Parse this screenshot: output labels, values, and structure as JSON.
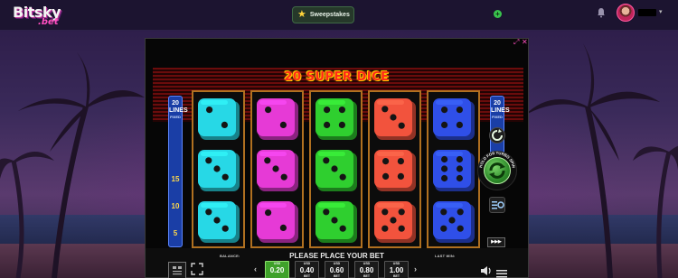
{
  "site": {
    "logo_main": "Bitsky",
    "logo_sub": ".bet",
    "sweepstakes_label": "Sweepstakes",
    "add_label": "+",
    "user_caret": "▾",
    "colors": {
      "accent": "#ff4fc0",
      "topbar": "#1c1430",
      "positive": "#39c24d"
    },
    "icons": [
      "star-icon",
      "plus-icon",
      "bell-icon",
      "avatar",
      "chevron-down-icon"
    ]
  },
  "game": {
    "title": "20 SUPER DICE",
    "window_controls": {
      "expand": "⤢",
      "close": "✕"
    },
    "lines_left": {
      "count": "20",
      "label": "LINES",
      "sub": "FIXED",
      "markers": [
        "15",
        "10",
        "5",
        "1"
      ]
    },
    "lines_right": {
      "count": "20",
      "label": "LINES",
      "sub": "FIXED"
    },
    "reels": [
      {
        "color": "#27d8e6",
        "faces": [
          2,
          3,
          3
        ]
      },
      {
        "color": "#e63ad6",
        "faces": [
          2,
          3,
          2
        ]
      },
      {
        "color": "#2fcf2f",
        "faces": [
          4,
          3,
          3
        ]
      },
      {
        "color": "#f2533d",
        "faces": [
          3,
          4,
          5
        ]
      },
      {
        "color": "#2f4fe8",
        "faces": [
          4,
          6,
          5
        ]
      }
    ],
    "message": "PLEASE PLACE YOUR BET",
    "balance_label": "BALANCE:",
    "last_win_label": "LAST WIN:",
    "turbo_text": "HOLD FOR TURBO SPIN",
    "bets": [
      {
        "currency": "USD",
        "value": "0.20",
        "label": "BET",
        "active": true
      },
      {
        "currency": "USD",
        "value": "0.40",
        "label": "BET",
        "active": false
      },
      {
        "currency": "USD",
        "value": "0.60",
        "label": "BET",
        "active": false
      },
      {
        "currency": "USD",
        "value": "0.80",
        "label": "BET",
        "active": false
      },
      {
        "currency": "USD",
        "value": "1.00",
        "label": "BET",
        "active": false
      }
    ],
    "autoplay_label": "▶▶▶",
    "icons": [
      "info-icon",
      "fullscreen-icon",
      "sound-icon",
      "menu-icon",
      "settings-icon",
      "autoplay-icon",
      "refresh-icon"
    ]
  }
}
